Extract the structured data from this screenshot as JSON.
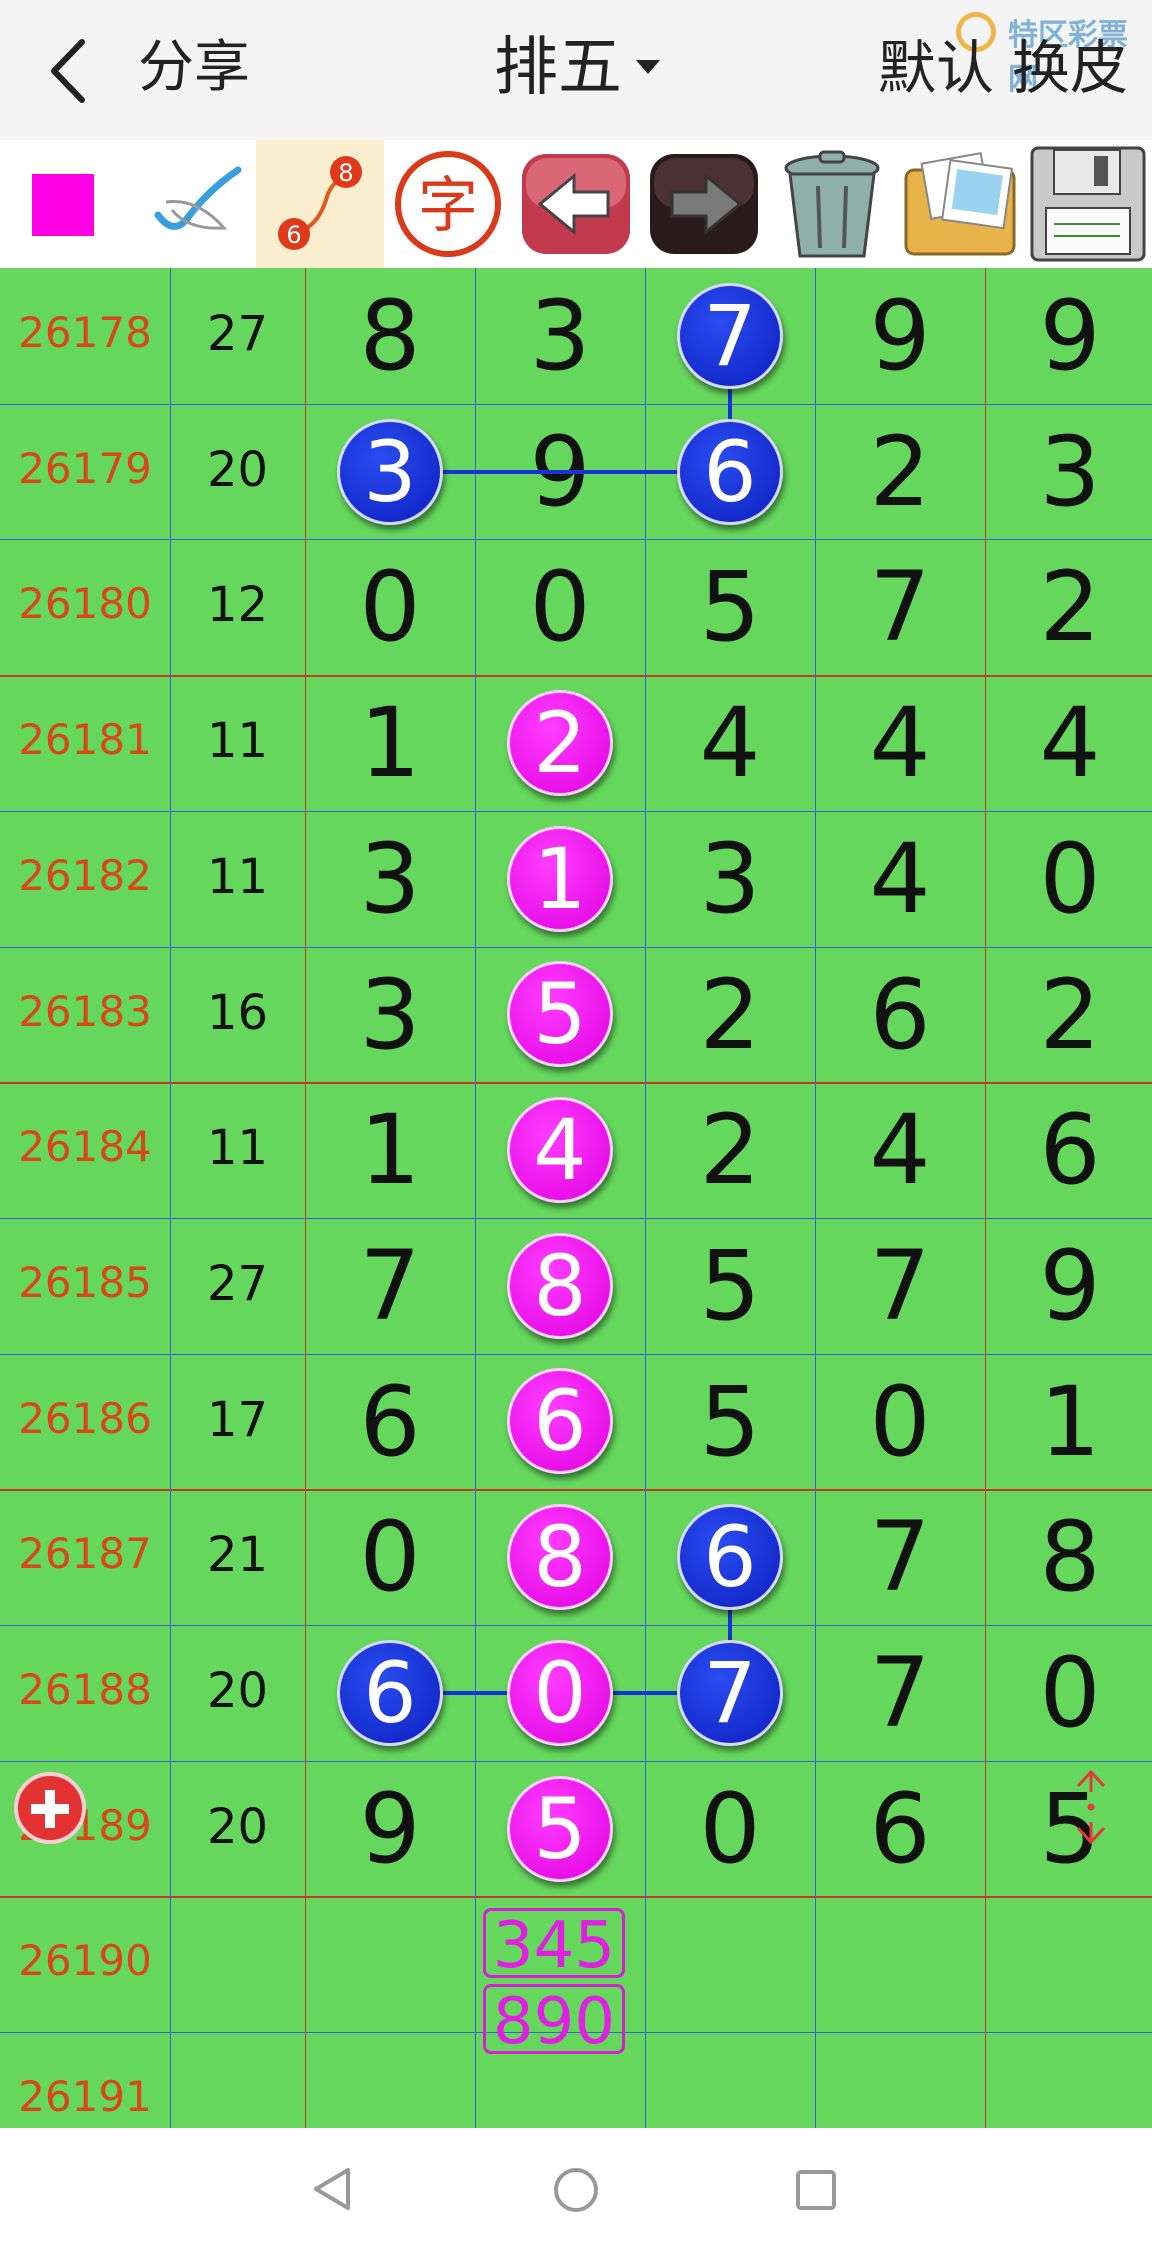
{
  "header": {
    "back_icon": "chevron-left-icon",
    "share_label": "分享",
    "title": "排五",
    "default_label": "默认",
    "skin_label": "换皮",
    "watermark": "特区彩票网"
  },
  "toolbar": {
    "tools": [
      "color-square-icon",
      "pen-icon",
      "link-numbers-icon",
      "text-char-icon",
      "undo-icon",
      "redo-icon",
      "trash-icon",
      "photos-icon",
      "save-disk-icon"
    ],
    "swatch_color": "#ff00e6",
    "char_label": "字",
    "link_top": "8",
    "link_bottom": "6"
  },
  "rows": [
    {
      "period": "26178",
      "sum": "27",
      "digits": [
        "8",
        "3",
        "7",
        "9",
        "9"
      ]
    },
    {
      "period": "26179",
      "sum": "20",
      "digits": [
        "3",
        "9",
        "6",
        "2",
        "3"
      ]
    },
    {
      "period": "26180",
      "sum": "12",
      "digits": [
        "0",
        "0",
        "5",
        "7",
        "2"
      ]
    },
    {
      "period": "26181",
      "sum": "11",
      "digits": [
        "1",
        "2",
        "4",
        "4",
        "4"
      ]
    },
    {
      "period": "26182",
      "sum": "11",
      "digits": [
        "3",
        "1",
        "3",
        "4",
        "0"
      ]
    },
    {
      "period": "26183",
      "sum": "16",
      "digits": [
        "3",
        "5",
        "2",
        "6",
        "2"
      ]
    },
    {
      "period": "26184",
      "sum": "11",
      "digits": [
        "1",
        "4",
        "2",
        "4",
        "6"
      ]
    },
    {
      "period": "26185",
      "sum": "27",
      "digits": [
        "7",
        "8",
        "5",
        "7",
        "9"
      ]
    },
    {
      "period": "26186",
      "sum": "17",
      "digits": [
        "6",
        "6",
        "5",
        "0",
        "1"
      ]
    },
    {
      "period": "26187",
      "sum": "21",
      "digits": [
        "0",
        "8",
        "6",
        "7",
        "8"
      ]
    },
    {
      "period": "26188",
      "sum": "20",
      "digits": [
        "6",
        "0",
        "7",
        "7",
        "0"
      ]
    },
    {
      "period": "26189",
      "sum": "20",
      "digits": [
        "9",
        "5",
        "0",
        "6",
        "5"
      ]
    },
    {
      "period": "26190",
      "sum": "",
      "digits": [
        "",
        "",
        "",
        "",
        ""
      ]
    },
    {
      "period": "26191",
      "sum": "",
      "digits": [
        "",
        "",
        "",
        "",
        ""
      ]
    }
  ],
  "highlights": {
    "blue": [
      [
        0,
        2
      ],
      [
        1,
        0
      ],
      [
        1,
        2
      ],
      [
        9,
        2
      ],
      [
        10,
        0
      ],
      [
        10,
        2
      ]
    ],
    "pink": [
      [
        3,
        1
      ],
      [
        4,
        1
      ],
      [
        5,
        1
      ],
      [
        6,
        1
      ],
      [
        7,
        1
      ],
      [
        8,
        1
      ],
      [
        9,
        1
      ],
      [
        10,
        1
      ],
      [
        11,
        1
      ]
    ],
    "blue_color": "#1228cf",
    "pink_color": "#ee00ee"
  },
  "prediction": {
    "line1": "345",
    "line2": "890"
  },
  "colors": {
    "grid_bg": "#64d75c",
    "period_text": "#d8471a",
    "prediction": "#e11ee1"
  },
  "controls": {
    "add_icon": "add-circle-icon",
    "scroll_icon": "scroll-arrows-icon"
  },
  "navbar": {
    "icons": [
      "nav-back-icon",
      "nav-home-icon",
      "nav-recents-icon"
    ]
  }
}
